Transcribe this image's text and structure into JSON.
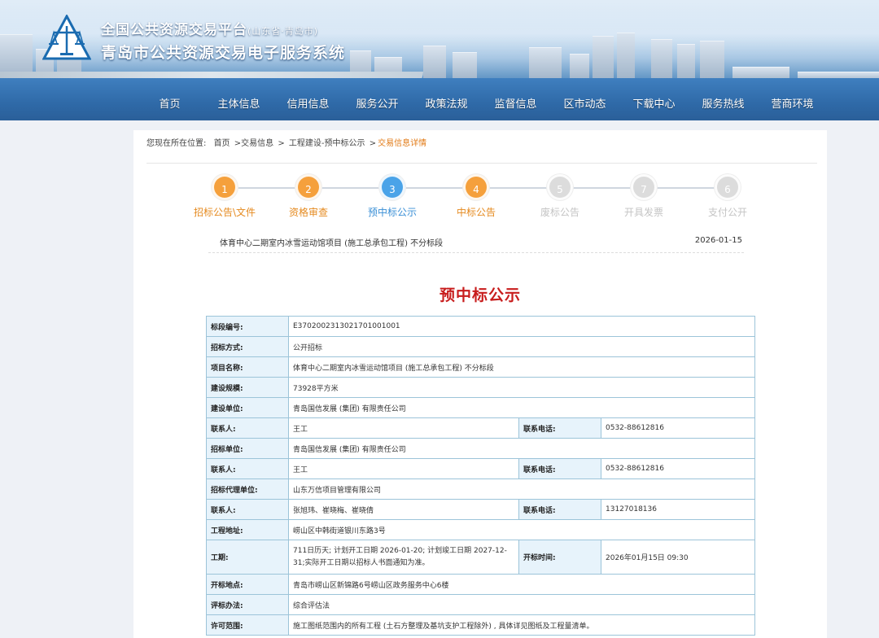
{
  "header": {
    "title_main": "全国公共资源交易平台",
    "title_region": "(山东省·青岛市)",
    "title_system": "青岛市公共资源交易电子服务系统",
    "nav": [
      "首页",
      "主体信息",
      "信用信息",
      "服务公开",
      "政策法规",
      "监督信息",
      "区市动态",
      "下载中心",
      "服务热线",
      "营商环境"
    ]
  },
  "breadcrumb": {
    "prefix": "您现在所在位置:",
    "items": [
      "首页",
      ">交易信息",
      ">",
      "工程建设-预中标公示",
      ">"
    ],
    "current": "交易信息详情"
  },
  "steps": [
    {
      "num": "1",
      "label": "招标公告\\文件",
      "color": "#f5a03c",
      "text_color": "#e58a1f"
    },
    {
      "num": "2",
      "label": "资格审查",
      "color": "#f5a03c",
      "text_color": "#e58a1f"
    },
    {
      "num": "3",
      "label": "预中标公示",
      "color": "#4aa3e8",
      "text_color": "#3a8fd6"
    },
    {
      "num": "4",
      "label": "中标公告",
      "color": "#f5a03c",
      "text_color": "#e58a1f"
    },
    {
      "num": "5",
      "label": "废标公告",
      "color": "#dcdcdc",
      "text_color": "#c4c4c4"
    },
    {
      "num": "7",
      "label": "开具发票",
      "color": "#dcdcdc",
      "text_color": "#c4c4c4"
    },
    {
      "num": "6",
      "label": "支付公开",
      "color": "#dcdcdc",
      "text_color": "#c4c4c4"
    }
  ],
  "notice": {
    "project": "体育中心二期室内冰雪运动馆项目 (施工总承包工程) 不分标段",
    "date": "2026-01-15",
    "title": "预中标公示"
  },
  "table": {
    "section_no_label": "标段编号:",
    "section_no": "E3702002313021701001001",
    "method_label": "招标方式:",
    "method": "公开招标",
    "project_label": "项目名称:",
    "project": "体育中心二期室内冰雪运动馆项目 (施工总承包工程) 不分标段",
    "scale_label": "建设规模:",
    "scale": "73928平方米",
    "builder_label": "建设单位:",
    "builder": "青岛国信发展 (集团) 有限责任公司",
    "contact_label": "联系人:",
    "phone_label": "联系电话:",
    "builder_contact": "王工",
    "builder_phone": "0532-88612816",
    "tenderer_label": "招标单位:",
    "tenderer": "青岛国信发展 (集团) 有限责任公司",
    "tenderer_contact": "王工",
    "tenderer_phone": "0532-88612816",
    "agent_label": "招标代理单位:",
    "agent": "山东万信项目管理有限公司",
    "agent_contact": "张旭玮、崔晓梅、崔晓倩",
    "agent_phone": "13127018136",
    "address_label": "工程地址:",
    "address": "崂山区中韩街道银川东路3号",
    "period_label": "工期:",
    "period": "711日历天; 计划开工日期 2026-01-20; 计划竣工日期 2027-12-31;实际开工日期以招标人书面通知为准。",
    "open_time_label": "开标时间:",
    "open_time": "2026年01月15日 09:30",
    "open_place_label": "开标地点:",
    "open_place": "青岛市崂山区新锦路6号崂山区政务服务中心6楼",
    "eval_label": "评标办法:",
    "eval": "综合评估法",
    "scope_label": "许可范围:",
    "scope": "施工图纸范围内的所有工程 (土石方整理及基坑支护工程除外) , 具体详见图纸及工程量清单。"
  }
}
